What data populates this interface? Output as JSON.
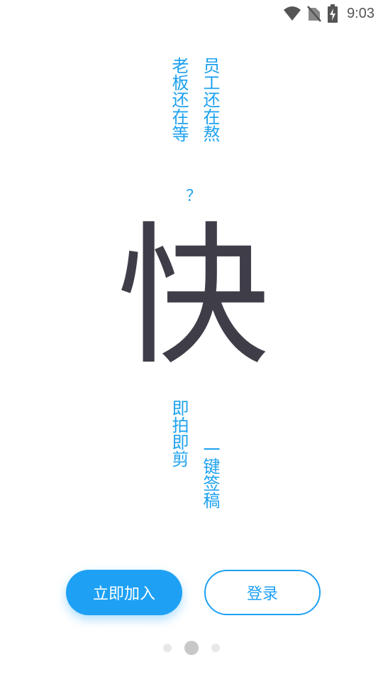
{
  "status_bar": {
    "time": "9:03",
    "icons": [
      "wifi-icon",
      "no-sim-icon",
      "battery-charging-icon"
    ]
  },
  "slogan": {
    "boss_column": "老板还在等",
    "staff_column": "员工还在熬",
    "question_mark": "？",
    "big_character": "快",
    "shoot_column": "即拍即剪",
    "sign_column": "一键签稿"
  },
  "actions": {
    "join_label": "立即加入",
    "login_label": "登录"
  },
  "pager": {
    "count": 3,
    "active_index": 1
  },
  "colors": {
    "accent": "#1ea1f5",
    "text_dark": "#3f3d48",
    "background": "#ffffff"
  }
}
